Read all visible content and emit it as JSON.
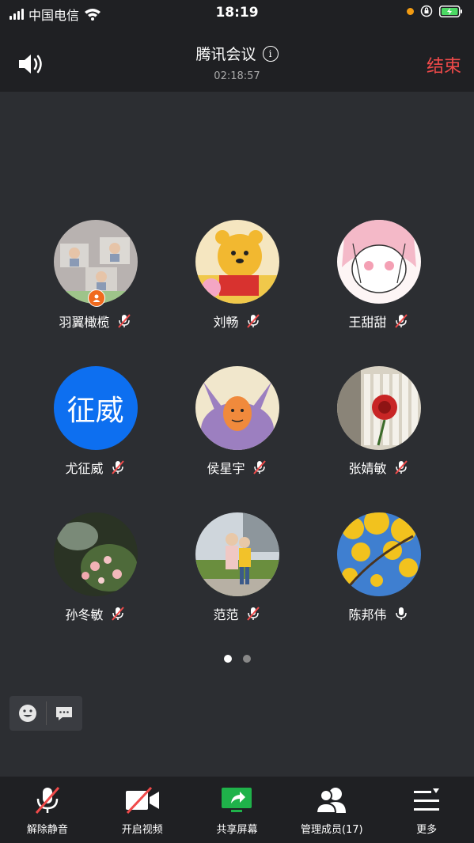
{
  "status_bar": {
    "carrier": "中国电信",
    "time": "18:19"
  },
  "header": {
    "title": "腾讯会议",
    "timer": "02:18:57",
    "end_label": "结束"
  },
  "participants": [
    {
      "name": "羽翼橄榄",
      "muted": true,
      "host": true,
      "avatar": "photo-kids"
    },
    {
      "name": "刘畅",
      "muted": true,
      "avatar": "winnie-the-pooh"
    },
    {
      "name": "王甜甜",
      "muted": true,
      "avatar": "anime-girl"
    },
    {
      "name": "尤征威",
      "muted": true,
      "avatar_text": "征威"
    },
    {
      "name": "侯星宇",
      "muted": true,
      "avatar": "cartoon-girl"
    },
    {
      "name": "张婧敏",
      "muted": true,
      "avatar": "rose-piano"
    },
    {
      "name": "孙冬敏",
      "muted": true,
      "avatar": "roses"
    },
    {
      "name": "范范",
      "muted": true,
      "avatar": "two-girls"
    },
    {
      "name": "陈邦伟",
      "muted": false,
      "avatar": "yellow-leaves"
    }
  ],
  "pager": {
    "pages": 2,
    "current": 1
  },
  "toolbar": {
    "unmute": "解除静音",
    "video": "开启视频",
    "share": "共享屏幕",
    "members": "管理成员(17)",
    "more": "更多"
  },
  "colors": {
    "end": "#f04a4a",
    "host_badge": "#f06a1e",
    "avatar_blue": "#0d6ff0",
    "share_green": "#1fb24a"
  }
}
